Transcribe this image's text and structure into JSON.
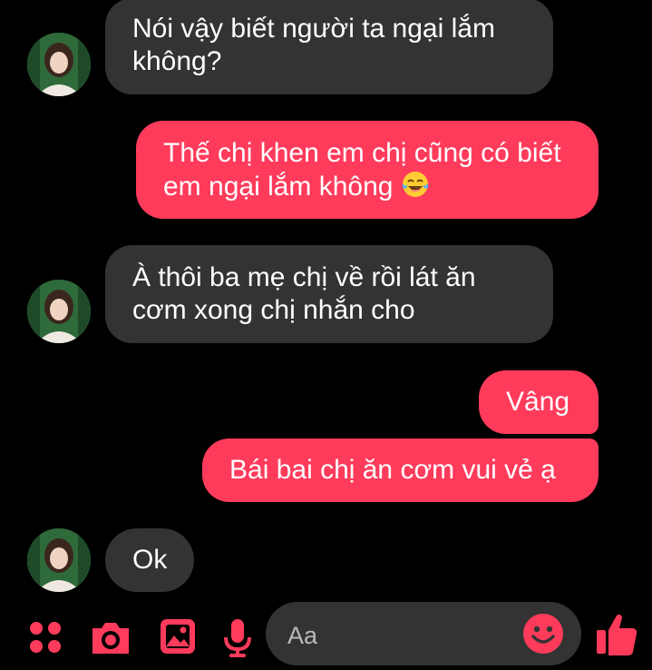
{
  "colors": {
    "accent": "#ff3b5c",
    "incoming_bubble": "#333333",
    "outgoing_bubble": "#ff3b5c",
    "background": "#000000",
    "text": "#ffffff"
  },
  "messages": [
    {
      "direction": "incoming",
      "text": "Nói vậy biết người ta ngại lắm không?"
    },
    {
      "direction": "outgoing",
      "text": "Thế chị khen em chị cũng có biết em ngại lắm không",
      "emoji": "face-with-tears-of-joy"
    },
    {
      "direction": "incoming",
      "text": "À thôi ba mẹ chị về rồi lát ăn cơm xong chị nhắn cho"
    },
    {
      "direction": "outgoing",
      "text": "Vâng"
    },
    {
      "direction": "outgoing",
      "text": "Bái bai chị ăn cơm vui vẻ ạ"
    },
    {
      "direction": "incoming",
      "text": "Ok"
    }
  ],
  "composer": {
    "placeholder": "Aa",
    "icons": [
      "apps-grid-icon",
      "camera-icon",
      "image-icon",
      "microphone-icon",
      "emoji-icon",
      "thumbs-up-icon"
    ]
  }
}
